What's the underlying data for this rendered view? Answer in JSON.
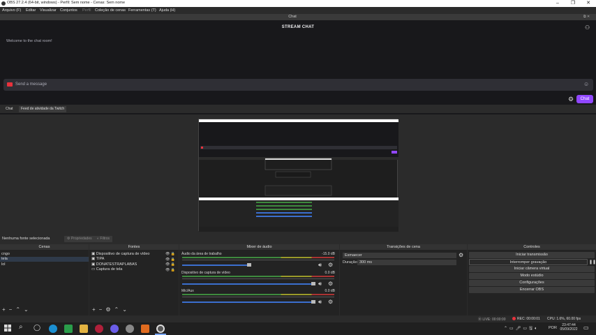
{
  "window": {
    "title": "OBS 27.2.4 (64-bit, windows) - Perfil: Sem nome - Cenas: Sem nome"
  },
  "menu": [
    "Arquivo (F)",
    "Editar",
    "Visualizar",
    "Conjuntos",
    "Perfil",
    "Coleção de cenas",
    "Ferramentas (T)",
    "Ajuda (H)"
  ],
  "chat": {
    "dock_title": "Chat",
    "header": "STREAM CHAT",
    "welcome": "Welcome to the chat room!",
    "input_placeholder": "Send a message",
    "chat_button": "Chat"
  },
  "tabs": [
    "Chat",
    "Feed de atividade da Twitch"
  ],
  "source_status": {
    "selected": "Nenhuma fonte selecionada",
    "properties": "Propriedades",
    "filters": "Filtros"
  },
  "docks": {
    "scenes": "Cenas",
    "sources": "Fontes",
    "mixer": "Mixer de áudio",
    "transitions": "Transições de cena",
    "controls": "Controles"
  },
  "scenes": [
    "cngo",
    "tela",
    "lol"
  ],
  "sources": [
    "Dispositivo de captura de vídeo",
    "TIPA",
    "DONATESTRAPLABAS",
    "Captura de tela"
  ],
  "mixer": [
    {
      "name": "Áudio da área de trabalho",
      "db": "-15.0 dB",
      "volume": 0.45
    },
    {
      "name": "Dispositivo de captura de vídeo",
      "db": "0.0 dB",
      "volume": 0.95
    },
    {
      "name": "Mic/Aux",
      "db": "0.0 dB",
      "volume": 0.95
    }
  ],
  "transitions": {
    "type": "Esmaecer",
    "duration_label": "Duração",
    "duration": "300 ms"
  },
  "controls": [
    "Iniciar transmissão",
    "Interromper gravação",
    "Iniciar câmera virtual",
    "Modo estúdio",
    "Configurações",
    "Encerrar OBS"
  ],
  "statusbar": {
    "live": "LIVE: 00:00:00",
    "rec": "REC: 00:00:01",
    "cpu": "CPU: 1.6%, 60.00 fps"
  },
  "taskbar": {
    "lang": "POR",
    "time": "23:47:44",
    "date": "05/09/2022"
  },
  "colors": {
    "twitch_purple": "#9147ff",
    "rec_red": "#e8323c"
  }
}
